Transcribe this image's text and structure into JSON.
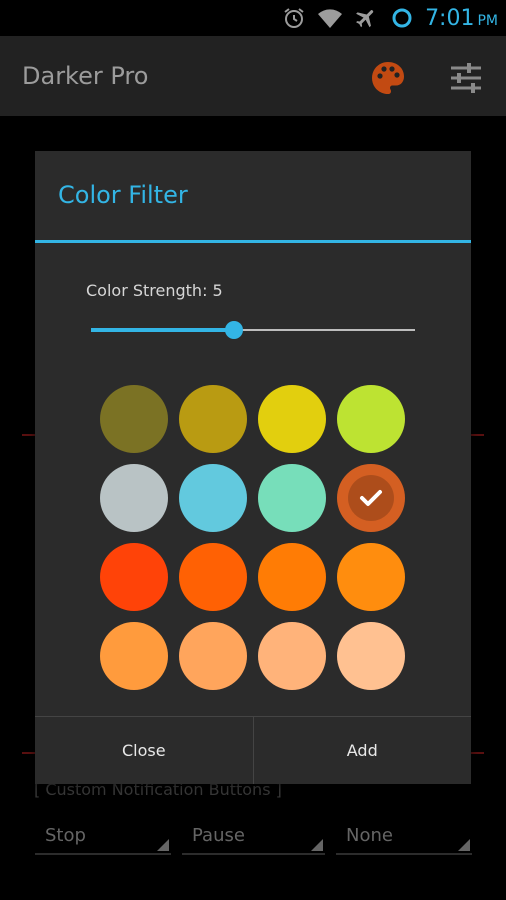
{
  "status_bar": {
    "time": "7:01",
    "ampm": "PM",
    "icons": [
      "alarm-icon",
      "wifi-icon",
      "airplane-icon",
      "sync-circle-icon"
    ]
  },
  "action_bar": {
    "title": "Darker Pro",
    "icons": [
      "palette-icon",
      "sliders-icon"
    ]
  },
  "background": {
    "section_title": "[ Custom Notification Buttons ]",
    "spinners": [
      "Stop",
      "Pause",
      "None"
    ]
  },
  "dialog": {
    "title": "Color Filter",
    "strength_label": "Color Strength: 5",
    "strength_fraction": 0.44,
    "swatches": [
      "#7b7224",
      "#b99b12",
      "#e2cf0e",
      "#bde332",
      "#b9c3c5",
      "#62c9de",
      "#77deba",
      "#d45f22",
      "#ff4308",
      "#ff6104",
      "#ff7c05",
      "#ff8d0e",
      "#ff9b3d",
      "#ffa55c",
      "#ffb37a",
      "#ffc191"
    ],
    "selected_index": 7,
    "buttons": {
      "close": "Close",
      "add": "Add"
    }
  },
  "colors": {
    "accent": "#33b5e5",
    "dialog_bg": "#2b2b2b",
    "actionbar_bg": "#222222"
  }
}
